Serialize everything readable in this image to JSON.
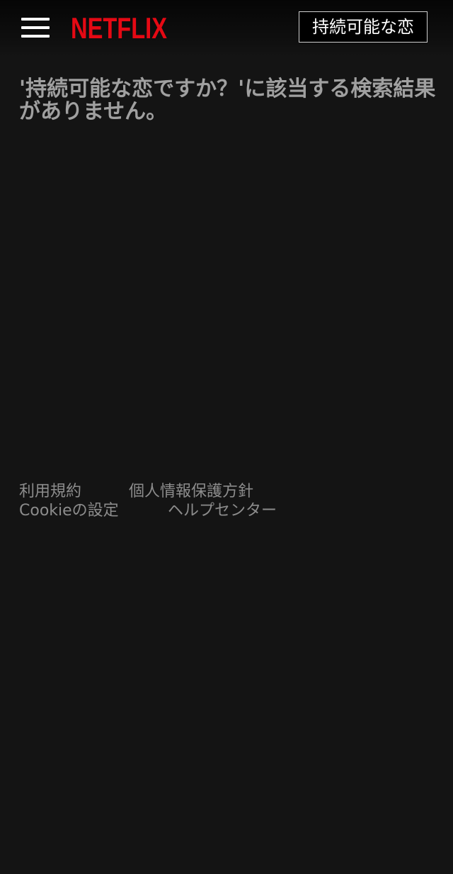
{
  "header": {
    "menu_icon": "hamburger-menu-icon",
    "logo_text": "NETFLIX",
    "logo_color": "#e50914",
    "search_value": "持続可能な恋"
  },
  "main": {
    "no_results_message": "'持続可能な恋ですか？'に該当する検索結果がありません。"
  },
  "footer": {
    "links": [
      "利用規約",
      "個人情報保護方針",
      "Cookieの設定",
      "ヘルプセンター"
    ]
  },
  "colors": {
    "background": "#141414",
    "text_muted": "#a0a0a0",
    "footer_text": "#8c8c8c"
  }
}
